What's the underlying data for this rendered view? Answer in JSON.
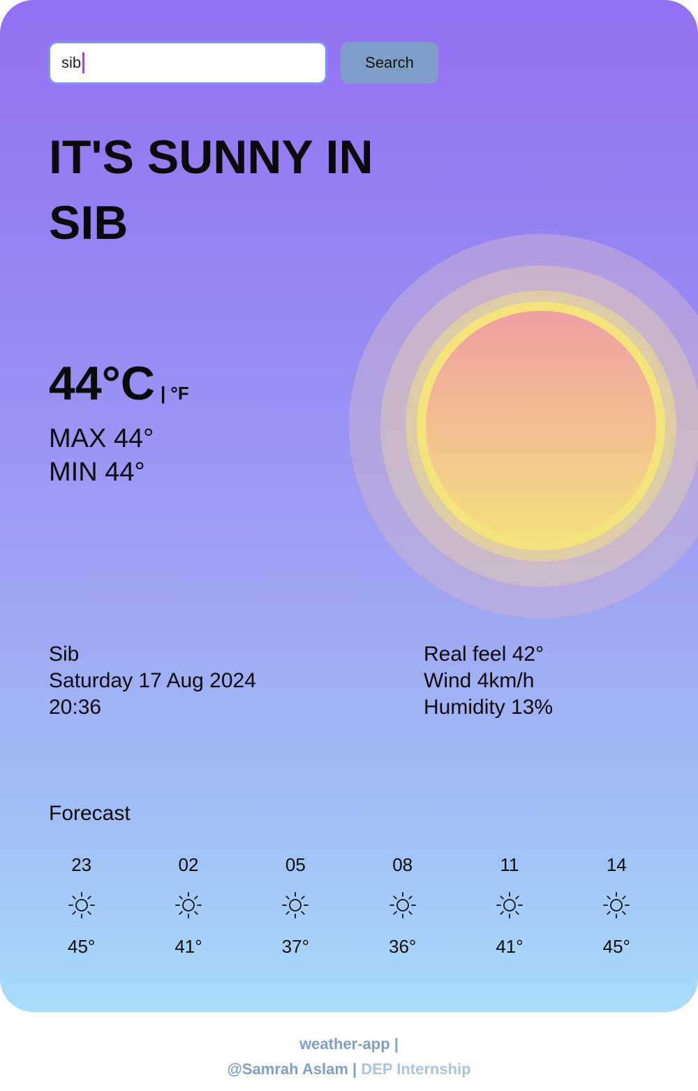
{
  "search": {
    "value": "sib",
    "button_label": "Search"
  },
  "headline": {
    "line1": "IT'S SUNNY IN",
    "line2": "SIB"
  },
  "current": {
    "temp": "44°C",
    "unit_toggle": "| °F",
    "max": "MAX 44°",
    "min": "MIN 44°"
  },
  "location": {
    "city": "Sib",
    "date": "Saturday 17 Aug 2024",
    "time": "20:36"
  },
  "details": {
    "real_feel": "Real feel 42°",
    "wind": "Wind 4km/h",
    "humidity": "Humidity 13%"
  },
  "forecast": {
    "title": "Forecast",
    "items": [
      {
        "hour": "23",
        "icon": "sun-icon",
        "temp": "45°"
      },
      {
        "hour": "02",
        "icon": "sun-icon",
        "temp": "41°"
      },
      {
        "hour": "05",
        "icon": "sun-icon",
        "temp": "37°"
      },
      {
        "hour": "08",
        "icon": "sun-icon",
        "temp": "36°"
      },
      {
        "hour": "11",
        "icon": "sun-icon",
        "temp": "41°"
      },
      {
        "hour": "14",
        "icon": "sun-icon",
        "temp": "45°"
      }
    ]
  },
  "footer": {
    "line1": "weather-app |",
    "author": "@Samrah Aslam |",
    "org": "DEP Internship"
  },
  "colors": {
    "gradient_top": "#9370f2",
    "gradient_bottom": "#a8dcfa",
    "button_bg": "#7f9ec9",
    "sun_top": "#f0a0a0",
    "sun_bottom": "#f4e07e"
  }
}
